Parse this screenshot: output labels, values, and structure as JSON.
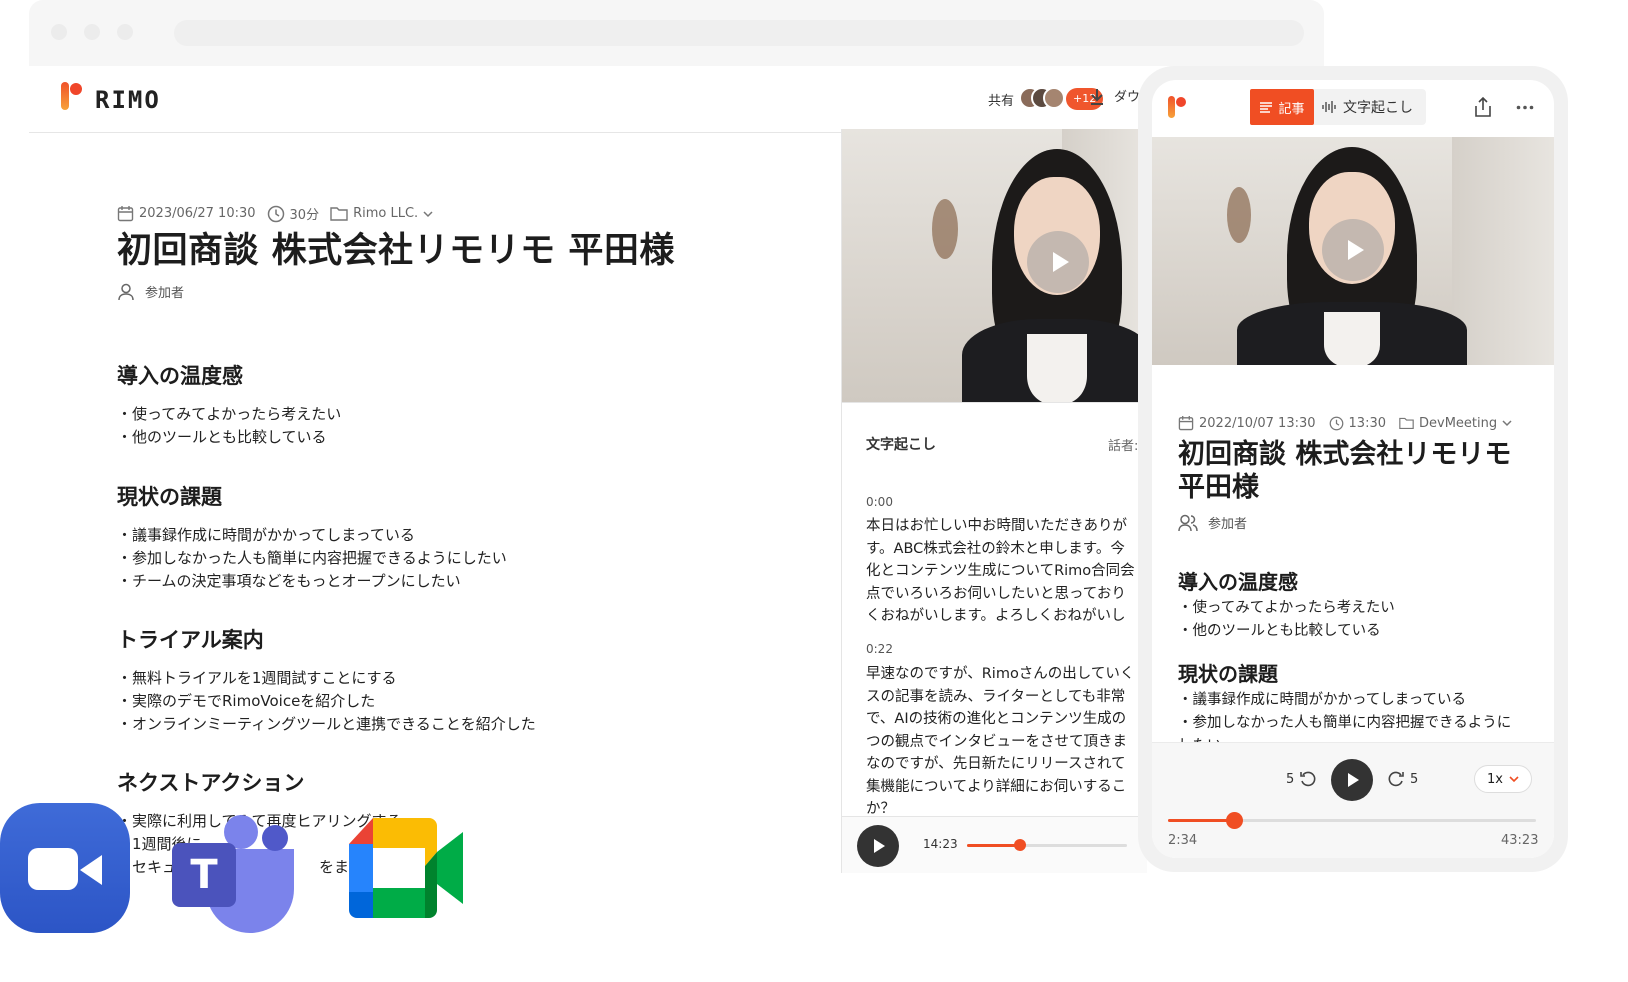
{
  "header": {
    "brand": "RIMO",
    "share_label": "共有",
    "avatar_count": "+12",
    "download_label": "ダウ"
  },
  "doc": {
    "date": "2023/06/27 10:30",
    "duration": "30分",
    "folder": "Rimo LLC.",
    "title": "初回商談 株式会社リモリモ 平田様",
    "participants_label": "参加者",
    "sections": [
      {
        "heading": "導入の温度感",
        "bullets": [
          "・使ってみてよかったら考えたい",
          "・他のツールとも比較している"
        ]
      },
      {
        "heading": "現状の課題",
        "bullets": [
          "・議事録作成に時間がかかってしまっている",
          "・参加しなかった人も簡単に内容把握できるようにしたい",
          "・チームの決定事項などをもっとオープンにしたい"
        ]
      },
      {
        "heading": "トライアル案内",
        "bullets": [
          "・無料トライアルを1週間試すことにする",
          "・実際のデモでRimoVoiceを紹介した",
          "・オンラインミーティングツールと連携できることを紹介した"
        ]
      },
      {
        "heading": "ネクストアクション",
        "bullets": [
          "・実際に利用してみて再度ヒアリングする",
          "・1週間後に",
          "・セキュ",
          "をまとめ"
        ]
      }
    ]
  },
  "transcript": {
    "heading": "文字起こし",
    "speaker_label": "話者:",
    "blocks": [
      {
        "time": "0:00",
        "lines": [
          "本日はお忙しい中お時間いただきありが",
          "す。ABC株式会社の鈴木と申します。今",
          "化とコンテンツ生成についてRimo合同会",
          "点でいろいろお伺いしたいと思っており",
          "くおねがいします。よろしくおねがいし"
        ]
      },
      {
        "time": "0:22",
        "lines": [
          "早速なのですが、Rimoさんの出していく",
          "スの記事を読み、ライターとしても非常",
          "で、AIの技術の進化とコンテンツ生成の",
          "つの観点でインタビューをさせて頂きま",
          "なのですが、先日新たにリリースされて",
          "集機能についてより詳細にお伺いするこ",
          "か？"
        ]
      }
    ],
    "player_time": "14:23",
    "player_progress": 0.33
  },
  "mobile": {
    "tab_article": "記事",
    "tab_transcript": "文字起こし",
    "date": "2022/10/07 13:30",
    "time": "13:30",
    "folder": "DevMeeting",
    "title": "初回商談 株式会社リモリモ 平田様",
    "participants_label": "参加者",
    "sections": [
      {
        "heading": "導入の温度感",
        "bullets": [
          "・使ってみてよかったら考えたい",
          "・他のツールとも比較している"
        ]
      },
      {
        "heading": "現状の課題",
        "bullets": [
          "・議事録作成に時間がかかってしまっている",
          "・参加しなかった人も簡単に内容把握できるように",
          "したい"
        ]
      }
    ],
    "skip_back": "5",
    "skip_fwd": "5",
    "speed": "1x",
    "elapsed": "2:34",
    "total": "43:23",
    "progress": 0.18
  },
  "colors": {
    "accent": "#f04e23",
    "badge": "#f0562d",
    "zoom": "#2d56c8",
    "teams": "#5059c9"
  },
  "icons": [
    "calendar-icon",
    "clock-icon",
    "folder-icon",
    "person-icon",
    "download-icon",
    "play-icon",
    "share-icon",
    "more-icon",
    "article-icon",
    "waveform-icon",
    "rewind-5-icon",
    "forward-5-icon",
    "chevron-down-icon",
    "zoom-icon",
    "teams-icon",
    "google-meet-icon"
  ]
}
